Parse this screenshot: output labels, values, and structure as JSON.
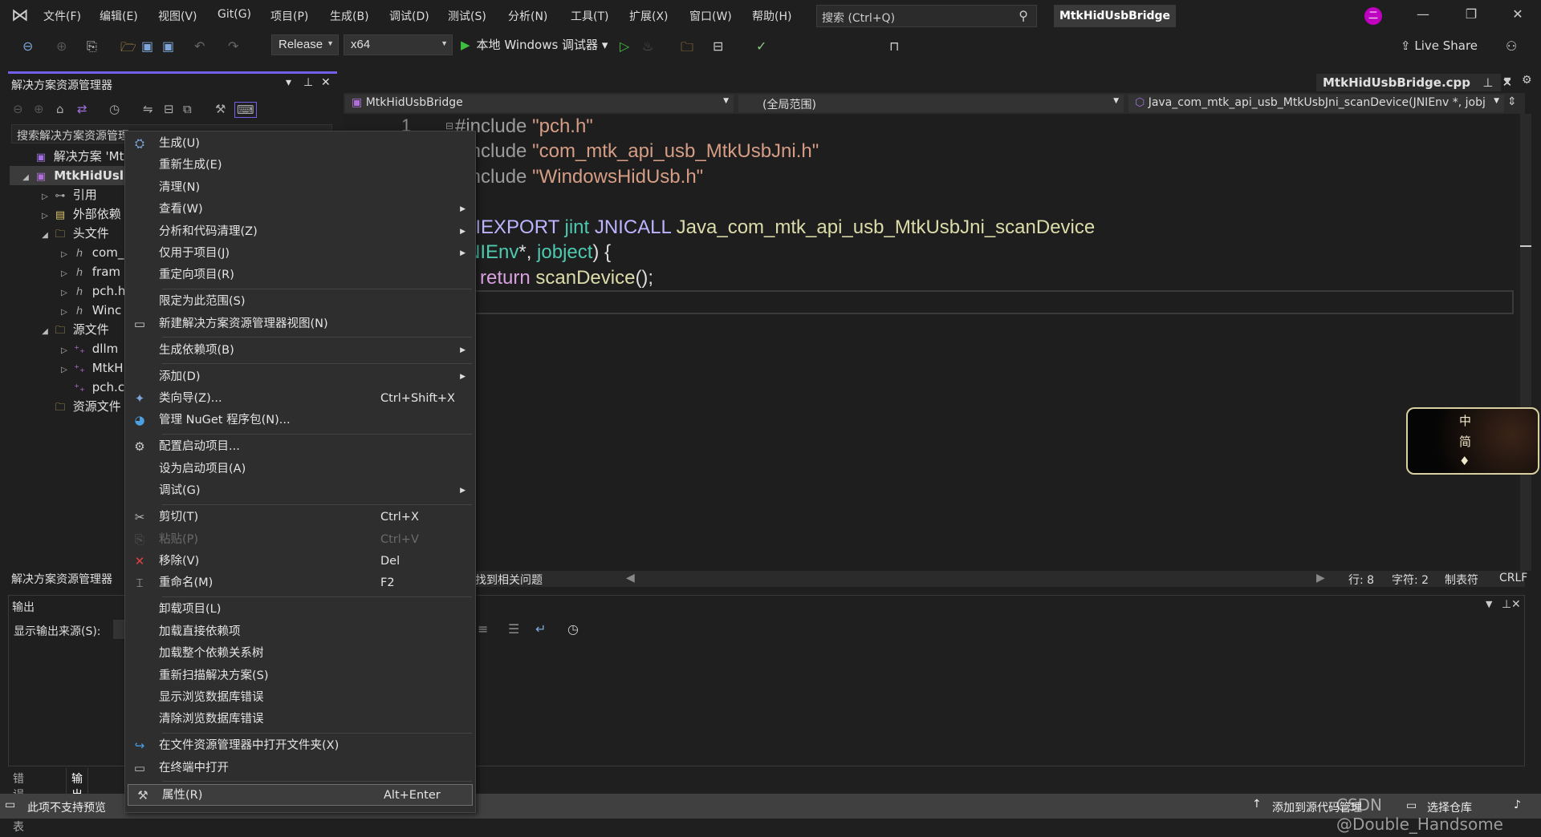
{
  "menubar": {
    "items": [
      "文件(F)",
      "编辑(E)",
      "视图(V)",
      "Git(G)",
      "项目(P)",
      "生成(B)",
      "调试(D)",
      "测试(S)",
      "分析(N)",
      "工具(T)",
      "扩展(X)",
      "窗口(W)",
      "帮助(H)"
    ],
    "search_placeholder": "搜索 (Ctrl+Q)",
    "title": "MtkHidUsbBridge",
    "avatar_initial": "二"
  },
  "toolbar": {
    "configuration": "Release",
    "platform": "x64",
    "run_label": "本地 Windows 调试器",
    "live_share": "Live Share"
  },
  "solution_explorer": {
    "title": "解决方案资源管理器",
    "search_placeholder": "搜索解决方案资源管理",
    "tree": [
      {
        "label": "解决方案 'Mtk",
        "icon": "solution-icon",
        "exp": ""
      },
      {
        "label": "MtkHidUsl",
        "icon": "project-icon",
        "exp": "◢",
        "selected": true
      },
      {
        "label": "引用",
        "icon": "references-icon",
        "exp": "▷"
      },
      {
        "label": "外部依赖",
        "icon": "external-deps-icon",
        "exp": "▷"
      },
      {
        "label": "头文件",
        "icon": "filter-folder-icon",
        "exp": "◢"
      },
      {
        "label": "com_",
        "icon": "header-file-icon",
        "exp": "▷"
      },
      {
        "label": "fram",
        "icon": "header-file-icon",
        "exp": "▷"
      },
      {
        "label": "pch.h",
        "icon": "header-file-icon",
        "exp": "▷"
      },
      {
        "label": "Winc",
        "icon": "header-file-icon",
        "exp": "▷"
      },
      {
        "label": "源文件",
        "icon": "filter-folder-icon",
        "exp": "◢"
      },
      {
        "label": "dllm",
        "icon": "cpp-file-icon",
        "exp": "▷"
      },
      {
        "label": "MtkH",
        "icon": "cpp-file-icon",
        "exp": "▷"
      },
      {
        "label": "pch.c",
        "icon": "cpp-file-icon",
        "exp": ""
      },
      {
        "label": "资源文件",
        "icon": "filter-folder-icon",
        "exp": ""
      }
    ],
    "footer_tab": "解决方案资源管理器"
  },
  "editor": {
    "tab": "MtkHidUsbBridge.cpp",
    "nav_project": "MtkHidUsbBridge",
    "nav_scope": "(全局范围)",
    "nav_member": "Java_com_mtk_api_usb_MtkUsbJni_scanDevice(JNIEnv *, jobj",
    "first_line_number": "1",
    "code": {
      "l1a": "#include ",
      "l1b": "\"pch.h\"",
      "l2a": "#include ",
      "l2b": "\"com_mtk_api_usb_MtkUsbJni.h\"",
      "l3a": "#include ",
      "l3b": "\"WindowsHidUsb.h\"",
      "l5a": "JNIEXPORT ",
      "l5b": "jint ",
      "l5c": "JNICALL ",
      "l5d": "Java_com_mtk_api_usb_MtkUsbJni_scanDevice",
      "l6a": "(JNIEnv",
      "l6b": "*, ",
      "l6c": "jobject",
      ")": ") {",
      "l7a": "return ",
      "l7b": "scanDevice",
      "l7c": "();"
    },
    "status": {
      "issues": "找到相关问题",
      "line": "行: 8",
      "char": "字符: 2",
      "indent": "制表符",
      "eol": "CRLF"
    },
    "ime": {
      "line1": "中",
      "line2": "简"
    }
  },
  "output": {
    "title": "输出",
    "source_label": "显示输出来源(S):"
  },
  "bottom_tabs": [
    "错误列表",
    "输出"
  ],
  "statusbar": {
    "message": "此项不支持预览",
    "source_control": "添加到源代码管理",
    "repo": "选择仓库",
    "watermark": "CSDN @Double_Handsome"
  },
  "context_menu": {
    "groups": [
      [
        {
          "label": "生成(U)",
          "icon": "build-icon"
        },
        {
          "label": "重新生成(E)"
        },
        {
          "label": "清理(N)"
        },
        {
          "label": "查看(W)",
          "submenu": true
        },
        {
          "label": "分析和代码清理(Z)",
          "submenu": true
        },
        {
          "label": "仅用于项目(J)",
          "submenu": true
        },
        {
          "label": "重定向项目(R)"
        }
      ],
      [
        {
          "label": "限定为此范围(S)"
        },
        {
          "label": "新建解决方案资源管理器视图(N)",
          "icon": "new-view-icon"
        }
      ],
      [
        {
          "label": "生成依赖项(B)",
          "submenu": true
        }
      ],
      [
        {
          "label": "添加(D)",
          "submenu": true
        },
        {
          "label": "类向导(Z)...",
          "shortcut": "Ctrl+Shift+X",
          "icon": "class-wizard-icon"
        },
        {
          "label": "管理 NuGet 程序包(N)...",
          "icon": "nuget-icon"
        }
      ],
      [
        {
          "label": "配置启动项目...",
          "icon": "gear-icon"
        },
        {
          "label": "设为启动项目(A)"
        },
        {
          "label": "调试(G)",
          "submenu": true
        }
      ],
      [
        {
          "label": "剪切(T)",
          "shortcut": "Ctrl+X",
          "icon": "cut-icon"
        },
        {
          "label": "粘贴(P)",
          "shortcut": "Ctrl+V",
          "icon": "paste-icon",
          "disabled": true
        },
        {
          "label": "移除(V)",
          "shortcut": "Del",
          "icon": "remove-icon"
        },
        {
          "label": "重命名(M)",
          "shortcut": "F2",
          "icon": "rename-icon"
        }
      ],
      [
        {
          "label": "卸载项目(L)"
        },
        {
          "label": "加载直接依赖项"
        },
        {
          "label": "加载整个依赖关系树"
        },
        {
          "label": "重新扫描解决方案(S)"
        },
        {
          "label": "显示浏览数据库错误"
        },
        {
          "label": "清除浏览数据库错误"
        }
      ],
      [
        {
          "label": "在文件资源管理器中打开文件夹(X)",
          "icon": "open-folder-icon"
        },
        {
          "label": "在终端中打开",
          "icon": "terminal-icon"
        }
      ],
      [
        {
          "label": "属性(R)",
          "shortcut": "Alt+Enter",
          "icon": "wrench-icon",
          "highlighted": true
        }
      ]
    ]
  },
  "colors": {
    "accent": "#7160e8",
    "avatar": "#c000c0",
    "remove": "#e04040"
  }
}
